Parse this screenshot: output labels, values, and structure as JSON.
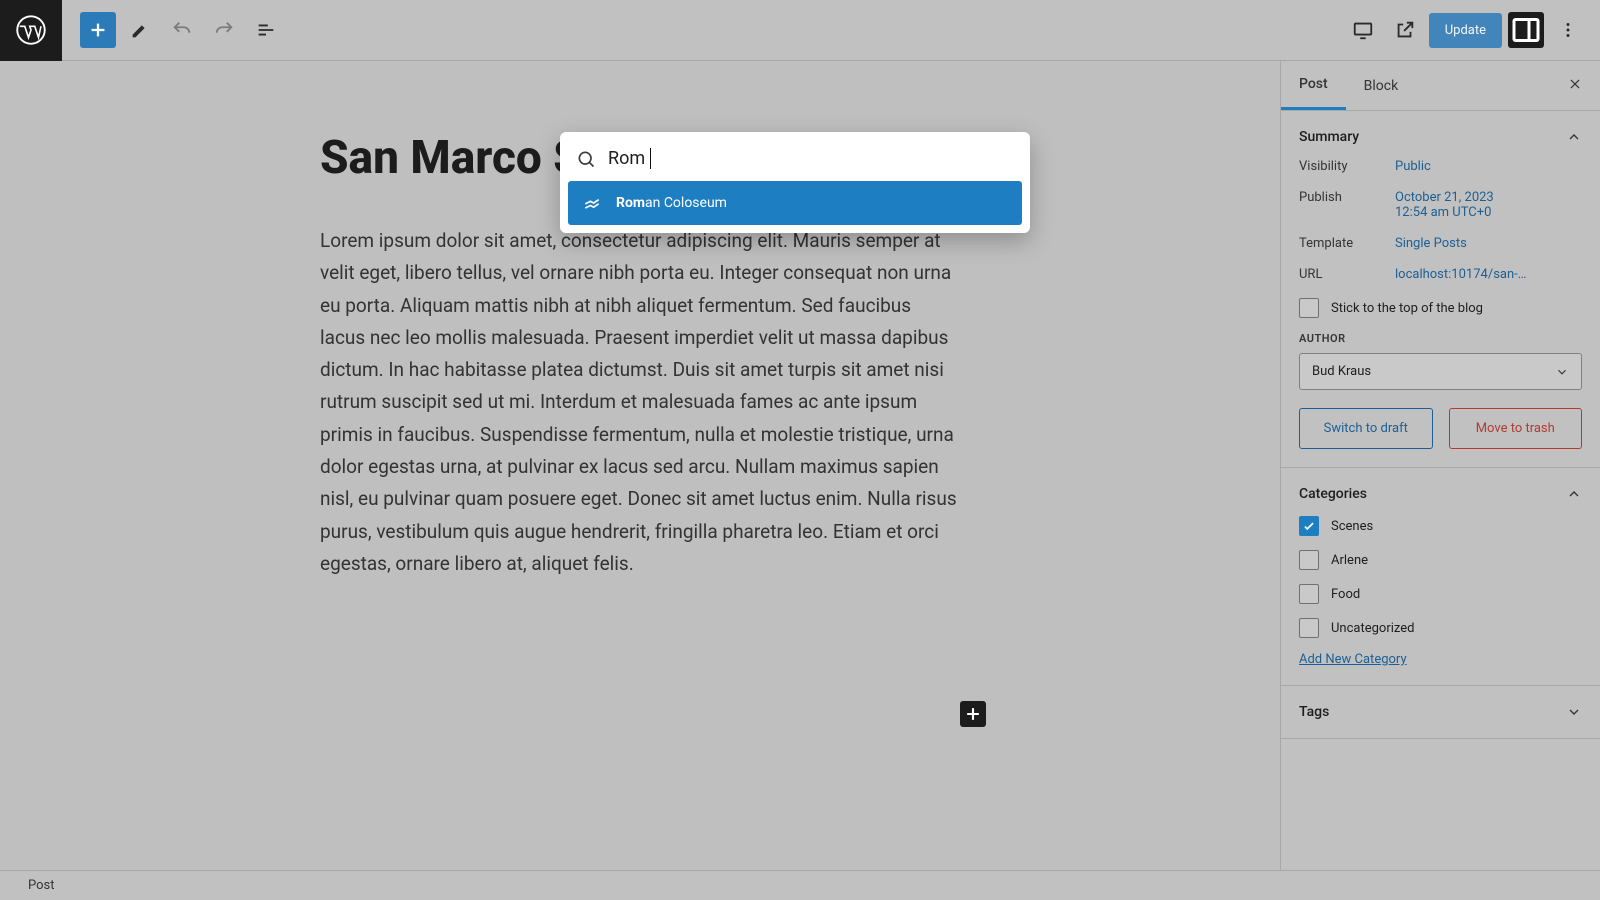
{
  "toolbar": {
    "update_label": "Update"
  },
  "post": {
    "title": "San Marco Squ",
    "body": "Lorem ipsum dolor sit amet, consectetur adipiscing elit. Mauris semper at velit eget, libero tellus, vel ornare nibh porta eu. Integer consequat non urna eu porta. Aliquam mattis nibh at nibh aliquet fermentum. Sed faucibus lacus nec leo mollis malesuada. Praesent imperdiet velit ut massa dapibus dictum. In hac habitasse platea dictumst. Duis sit amet turpis sit amet nisi rutrum suscipit sed ut mi. Interdum et malesuada fames ac ante ipsum primis in faucibus. Suspendisse fermentum, nulla et molestie tristique, urna dolor egestas urna, at pulvinar ex lacus sed arcu. Nullam maximus sapien nisl, eu pulvinar quam posuere eget. Donec sit amet luctus enim. Nulla risus purus, vestibulum quis augue hendrerit, fringilla pharetra leo. Etiam et orci egestas, ornare libero at, aliquet felis."
  },
  "popover": {
    "query": "Rom",
    "result_prefix": "Rom",
    "result_suffix": "an Coloseum"
  },
  "sidebar": {
    "tabs": {
      "post": "Post",
      "block": "Block"
    },
    "summary": {
      "title": "Summary",
      "visibility_k": "Visibility",
      "visibility_v": "Public",
      "publish_k": "Publish",
      "publish_line1": "October 21, 2023",
      "publish_line2": "12:54 am UTC+0",
      "template_k": "Template",
      "template_v": "Single Posts",
      "url_k": "URL",
      "url_v": "localhost:10174/san-…",
      "stick_label": "Stick to the top of the blog",
      "author_heading": "AUTHOR",
      "author_value": "Bud Kraus",
      "switch_draft": "Switch to draft",
      "move_trash": "Move to trash"
    },
    "categories": {
      "title": "Categories",
      "items": [
        {
          "label": "Scenes",
          "checked": true
        },
        {
          "label": "Arlene",
          "checked": false
        },
        {
          "label": "Food",
          "checked": false
        },
        {
          "label": "Uncategorized",
          "checked": false
        }
      ],
      "add_new": "Add New Category"
    },
    "tags": {
      "title": "Tags"
    }
  },
  "footer": {
    "breadcrumb": "Post"
  }
}
